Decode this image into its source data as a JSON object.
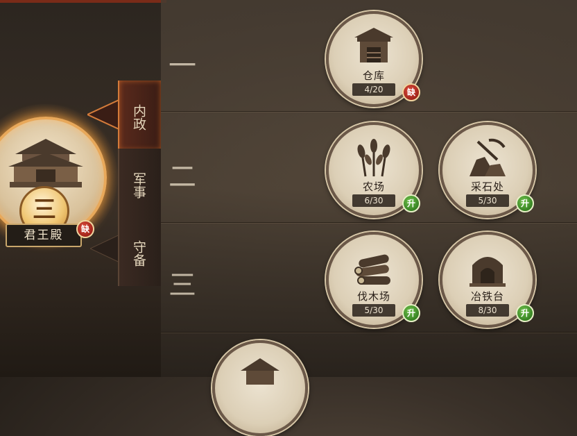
{
  "palace": {
    "name": "君王殿",
    "level_numeral": "三",
    "badge": "缺"
  },
  "tabs": [
    {
      "label": "内政",
      "active": true
    },
    {
      "label": "军事",
      "active": false
    },
    {
      "label": "守备",
      "active": false
    }
  ],
  "rows": [
    {
      "label": "一"
    },
    {
      "label": "二"
    },
    {
      "label": "三"
    }
  ],
  "buildings": [
    {
      "name": "仓库",
      "count": "4/20",
      "badge": "缺",
      "badge_type": "lack",
      "icon": "warehouse-icon"
    },
    {
      "name": "农场",
      "count": "6/30",
      "badge": "升",
      "badge_type": "upgrade",
      "icon": "wheat-icon"
    },
    {
      "name": "采石处",
      "count": "5/30",
      "badge": "升",
      "badge_type": "upgrade",
      "icon": "quarry-icon"
    },
    {
      "name": "伐木场",
      "count": "5/30",
      "badge": "升",
      "badge_type": "upgrade",
      "icon": "logs-icon"
    },
    {
      "name": "冶铁台",
      "count": "8/30",
      "badge": "升",
      "badge_type": "upgrade",
      "icon": "furnace-icon"
    }
  ],
  "colors": {
    "lack": "#9a1f16",
    "upgrade": "#2f7a1e",
    "active_tab_glow": "#d47b3a"
  }
}
